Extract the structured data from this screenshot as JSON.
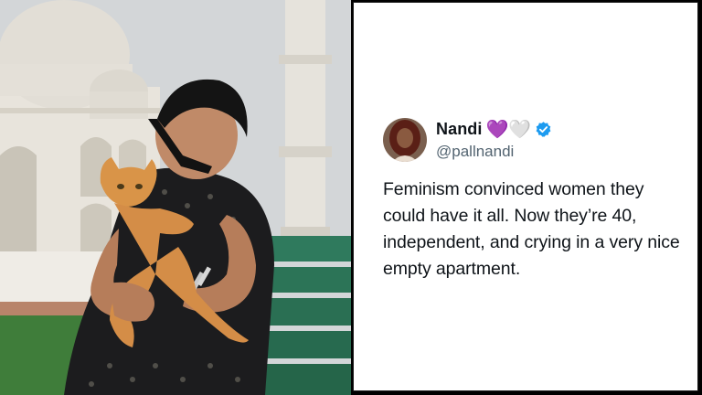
{
  "photo": {
    "description_icon": "photo",
    "colors": {
      "sky": "#d3d6d8",
      "marble": "#ece9e2",
      "bench": "#2f7a5d",
      "grass": "#3f7d3a",
      "cat": "#d9934a"
    }
  },
  "tweet": {
    "display_name": "Nandi",
    "hearts": [
      "💜",
      "🤍"
    ],
    "verified_icon": "verified-badge-icon",
    "handle": "@pallnandi",
    "text": "Feminism convinced women they could have it all. Now they’re 40, independent, and crying in a very nice empty apartment."
  },
  "colors": {
    "card_bg": "#ffffff",
    "text": "#0f1419",
    "handle": "#536471",
    "verified": "#1d9bf0"
  }
}
